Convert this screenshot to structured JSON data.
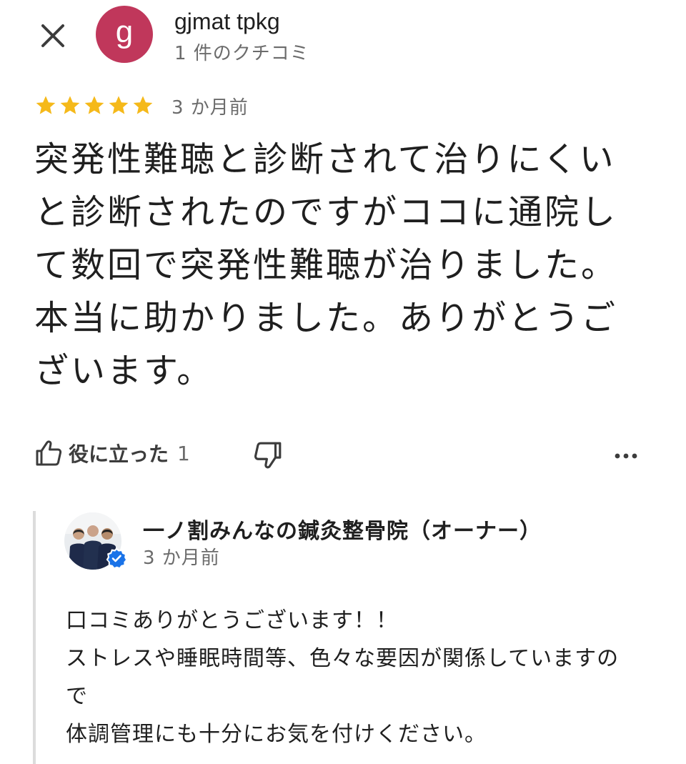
{
  "header": {
    "close_icon": "close-icon",
    "avatar_initial": "g",
    "avatar_color": "#c0375b",
    "reviewer_name": "gjmat tpkg",
    "review_count": "1 件のクチコミ"
  },
  "review": {
    "rating": 5,
    "max_rating": 5,
    "star_color": "#f5b91a",
    "date": "3 か月前",
    "text": "突発性難聴と診断されて治りにくいと診断されたのですがココに通院して数回で突発性難聴が治りました。本当に助かりました。ありがとうございます。"
  },
  "actions": {
    "helpful_icon": "thumbs-up-icon",
    "helpful_label": "役に立った",
    "helpful_count": "1",
    "dislike_icon": "thumbs-down-icon",
    "more_icon": "more-options-icon"
  },
  "owner_reply": {
    "name": "一ノ割みんなの鍼灸整骨院（オーナー）",
    "date": "3 か月前",
    "verified_icon": "verified-badge-icon",
    "verified_color": "#1a73e8",
    "lines": [
      "口コミありがとうございます！！",
      "ストレスや睡眠時間等、色々な要因が関係していますの",
      "で",
      "体調管理にも十分にお気を付けください。"
    ]
  }
}
